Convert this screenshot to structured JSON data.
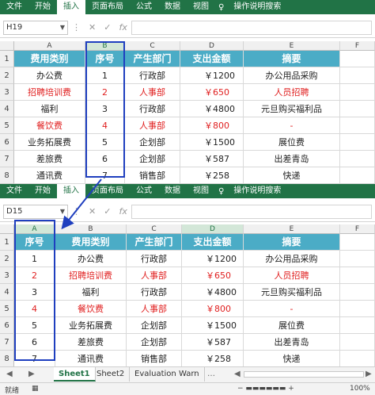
{
  "ribbon_tabs": [
    "文件",
    "开始",
    "插入",
    "页面布局",
    "公式",
    "数据",
    "视图",
    "操作说明搜索"
  ],
  "active_tab": 2,
  "top": {
    "cell_ref": "H19",
    "columns": [
      "A",
      "B",
      "C",
      "D",
      "E",
      "F"
    ],
    "rows": [
      "1",
      "2",
      "3",
      "4",
      "5",
      "6",
      "7",
      "8"
    ],
    "header": [
      "费用类别",
      "序号",
      "产生部门",
      "支出金额",
      "摘要"
    ],
    "data": [
      {
        "cat": "办公费",
        "no": "1",
        "dept": "行政部",
        "amt": "￥1200",
        "memo": "办公用品采购",
        "red": false
      },
      {
        "cat": "招聘培训费",
        "no": "2",
        "dept": "人事部",
        "amt": "￥650",
        "memo": "人员招聘",
        "red": true
      },
      {
        "cat": "福利",
        "no": "3",
        "dept": "行政部",
        "amt": "￥4800",
        "memo": "元旦购买福利品",
        "red": false
      },
      {
        "cat": "餐饮费",
        "no": "4",
        "dept": "人事部",
        "amt": "￥800",
        "memo": "-",
        "red": true
      },
      {
        "cat": "业务拓展费",
        "no": "5",
        "dept": "企划部",
        "amt": "￥1500",
        "memo": "展位费",
        "red": false
      },
      {
        "cat": "差旅费",
        "no": "6",
        "dept": "企划部",
        "amt": "￥587",
        "memo": "出差青岛",
        "red": false
      },
      {
        "cat": "通讯费",
        "no": "7",
        "dept": "销售部",
        "amt": "￥258",
        "memo": "快递",
        "red": false
      }
    ]
  },
  "bottom": {
    "cell_ref": "D15",
    "columns": [
      "A",
      "B",
      "C",
      "D",
      "E",
      "F"
    ],
    "rows": [
      "1",
      "2",
      "3",
      "4",
      "5",
      "6",
      "7",
      "8"
    ],
    "header": [
      "序号",
      "费用类别",
      "产生部门",
      "支出金额",
      "摘要"
    ]
  },
  "sheet_tabs": [
    "Sheet1",
    "Sheet2",
    "Evaluation Warn"
  ],
  "status": {
    "ready": "就绪",
    "zoom": "100%"
  },
  "colors": {
    "ribbon": "#217346",
    "header_fill": "#4bacc6",
    "highlight": "#1f3fbf",
    "red_text": "#e02020"
  }
}
